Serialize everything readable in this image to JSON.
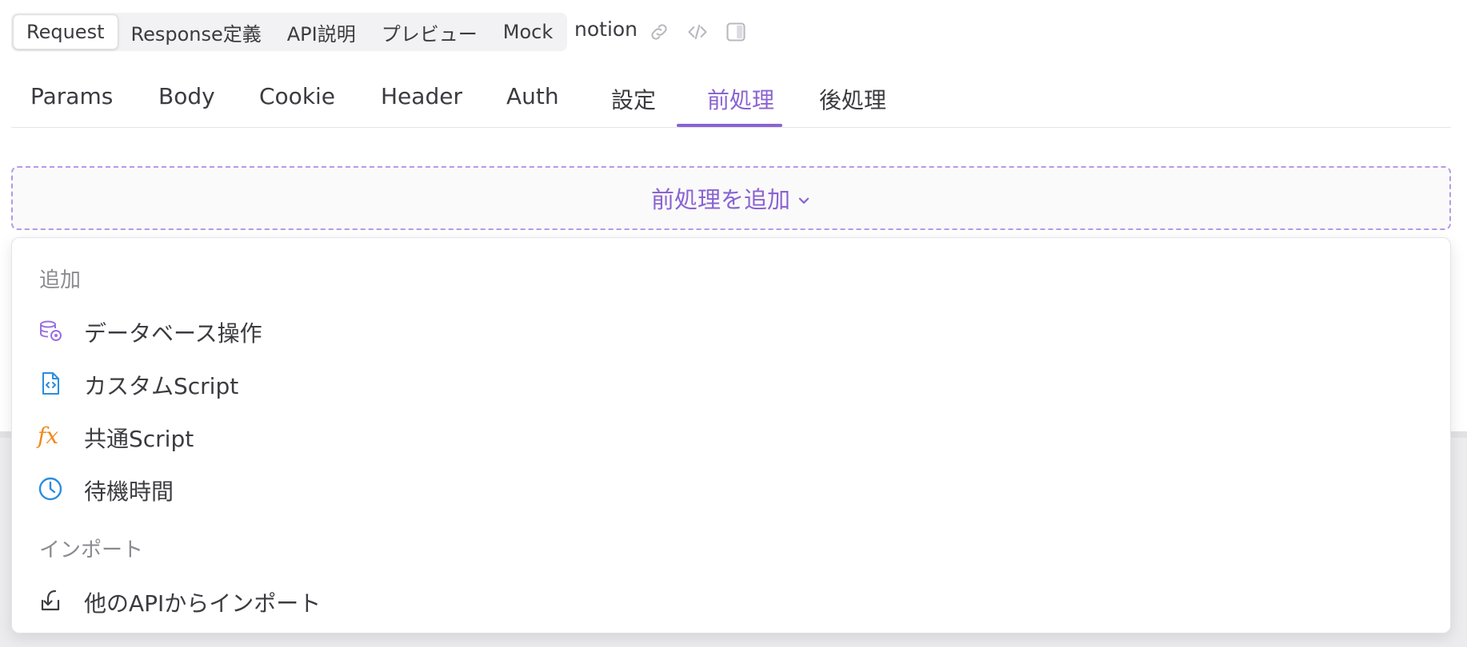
{
  "view_tabs": [
    {
      "label": "Request",
      "active": true
    },
    {
      "label": "Response定義",
      "active": false
    },
    {
      "label": "API説明",
      "active": false
    },
    {
      "label": "プレビュー",
      "active": false
    },
    {
      "label": "Mock",
      "active": false
    }
  ],
  "project": {
    "name": "notion"
  },
  "toolbar_icons": [
    "link-icon",
    "code-icon",
    "panel-toggle-icon"
  ],
  "request_tabs": [
    {
      "label": "Params"
    },
    {
      "label": "Body"
    },
    {
      "label": "Cookie"
    },
    {
      "label": "Header"
    },
    {
      "label": "Auth"
    },
    {
      "label": "設定"
    },
    {
      "label": "前処理",
      "active": true
    },
    {
      "label": "後処理"
    }
  ],
  "add_button": {
    "label": "前処理を追加",
    "icon": "chevron-down-icon"
  },
  "dropdown": {
    "group_add": "追加",
    "items_add": [
      {
        "label": "データベース操作",
        "icon": "database-icon"
      },
      {
        "label": "カスタムScript",
        "icon": "code-file-icon"
      },
      {
        "label": "共通Script",
        "icon": "fx-icon",
        "glyph": "fx"
      },
      {
        "label": "待機時間",
        "icon": "clock-icon"
      }
    ],
    "group_import": "インポート",
    "items_import": [
      {
        "label": "他のAPIからインポート",
        "icon": "import-icon"
      }
    ]
  },
  "colors": {
    "accent": "#8a63d2",
    "database_icon": "#9a70e0",
    "code_icon": "#2a8de0",
    "fx_icon": "#f08a1c",
    "clock_icon": "#2a8de0"
  }
}
